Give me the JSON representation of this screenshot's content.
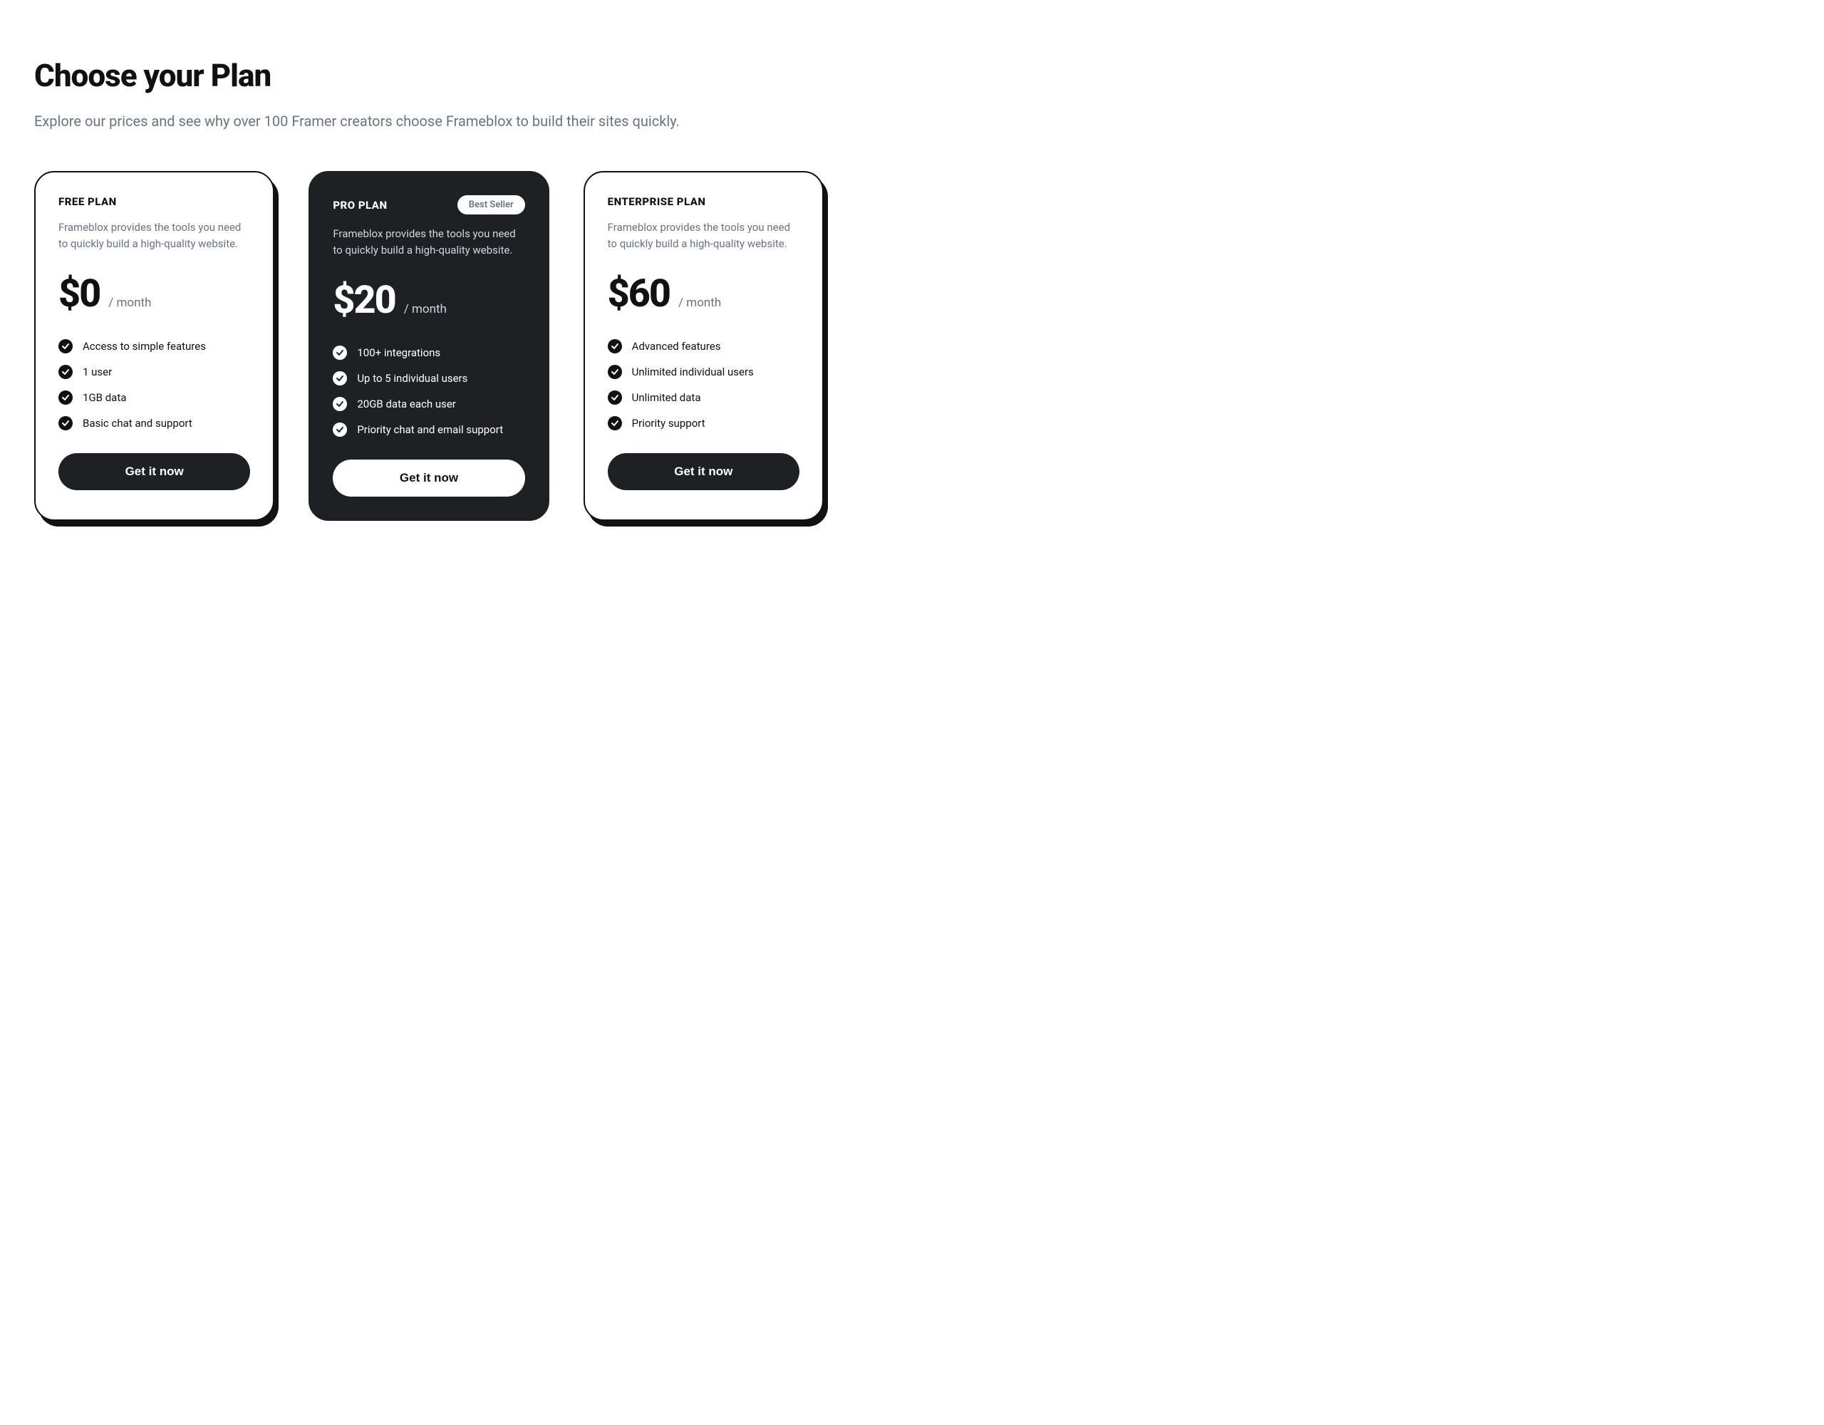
{
  "header": {
    "title": "Choose your Plan",
    "subtitle": "Explore our prices and see why over 100 Framer creators choose Frameblox to build their sites quickly."
  },
  "plans": [
    {
      "name": "FREE PLAN",
      "badge": null,
      "description": "Frameblox provides the tools you need to quickly build a high-quality website.",
      "price": "$0",
      "interval": "/ month",
      "features": [
        "Access to simple features",
        "1 user",
        "1GB data",
        "Basic chat and support"
      ],
      "cta": "Get it now",
      "variant": "light"
    },
    {
      "name": "PRO PLAN",
      "badge": "Best Seller",
      "description": "Frameblox provides the tools you need to quickly build a high-quality website.",
      "price": "$20",
      "interval": "/ month",
      "features": [
        "100+ integrations",
        "Up to 5 individual users",
        "20GB data each user",
        "Priority chat and email support"
      ],
      "cta": "Get it now",
      "variant": "dark"
    },
    {
      "name": "ENTERPRISE PLAN",
      "badge": null,
      "description": "Frameblox provides the tools you need to quickly build a high-quality website.",
      "price": "$60",
      "interval": "/ month",
      "features": [
        "Advanced features",
        "Unlimited individual users",
        "Unlimited data",
        "Priority support"
      ],
      "cta": "Get it now",
      "variant": "light"
    }
  ]
}
